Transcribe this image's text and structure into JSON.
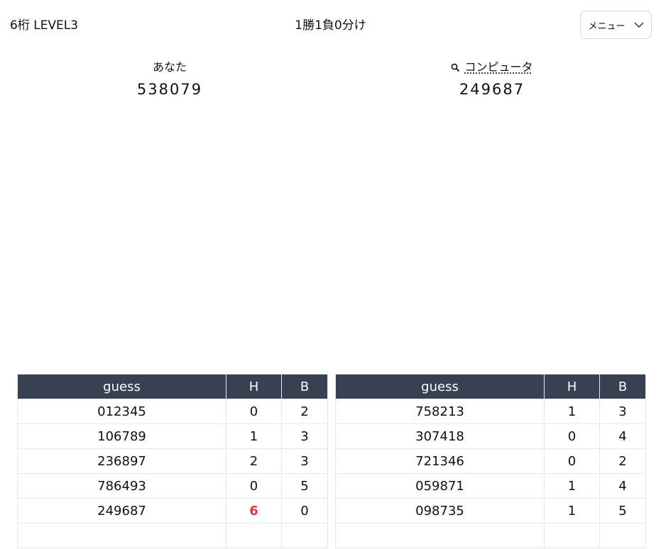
{
  "header": {
    "mode": "6桁 LEVEL3",
    "record": "1勝1負0分け",
    "menu_label": "メニュー"
  },
  "players": {
    "you": {
      "label": "あなた",
      "number": "538079"
    },
    "computer": {
      "label": "コンピュータ",
      "number": "249687"
    }
  },
  "columns": {
    "guess": "guess",
    "hit": "H",
    "blow": "B"
  },
  "you_history": [
    {
      "guess": "012345",
      "h": "0",
      "b": "2"
    },
    {
      "guess": "106789",
      "h": "1",
      "b": "3"
    },
    {
      "guess": "236897",
      "h": "2",
      "b": "3"
    },
    {
      "guess": "786493",
      "h": "0",
      "b": "5"
    },
    {
      "guess": "249687",
      "h": "6",
      "b": "0",
      "win": true
    },
    {
      "guess": "",
      "h": "",
      "b": ""
    }
  ],
  "computer_history": [
    {
      "guess": "758213",
      "h": "1",
      "b": "3"
    },
    {
      "guess": "307418",
      "h": "0",
      "b": "4"
    },
    {
      "guess": "721346",
      "h": "0",
      "b": "2"
    },
    {
      "guess": "059871",
      "h": "1",
      "b": "4"
    },
    {
      "guess": "098735",
      "h": "1",
      "b": "5"
    },
    {
      "guess": "",
      "h": "",
      "b": ""
    }
  ],
  "colors": {
    "table_header": "#374151",
    "win_hit": "#e23b3b"
  }
}
